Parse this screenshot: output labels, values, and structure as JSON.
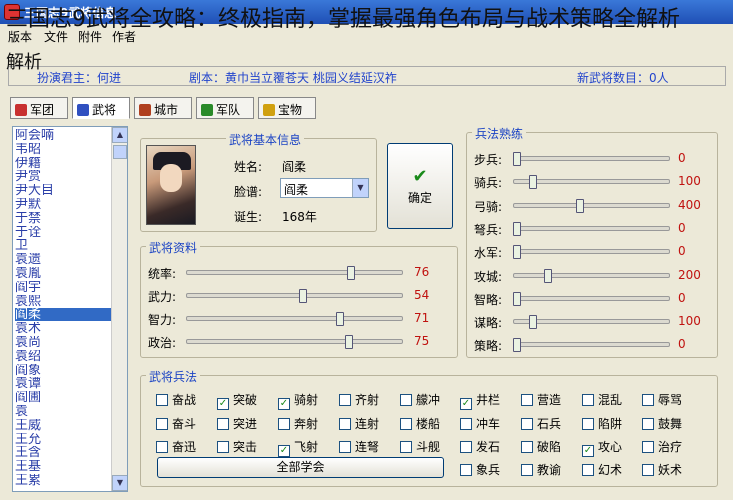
{
  "window": {
    "title": "三国志9武将信息"
  },
  "overlay": {
    "heading": "三国志9武将全攻略：终极指南，掌握最强角色布局与战术策略全解析",
    "tip": "解析"
  },
  "menu": [
    "版本",
    "文件",
    "附件",
    "作者"
  ],
  "infobar": {
    "ruler_label": "扮演君主：何进",
    "scenario_label": "剧本：黄巾当立覆苍天 桃园义结延汉祚",
    "new_generals_label": "新武将数目：0人"
  },
  "tabs": [
    {
      "label": "军团",
      "icon": "flag-icon",
      "color": "#c83030"
    },
    {
      "label": "武将",
      "icon": "general-icon",
      "color": "#3050c0"
    },
    {
      "label": "城市",
      "icon": "city-icon",
      "color": "#b04020"
    },
    {
      "label": "军队",
      "icon": "army-icon",
      "color": "#2a8a2a"
    },
    {
      "label": "宝物",
      "icon": "treasure-icon",
      "color": "#d0a010"
    }
  ],
  "general_list": {
    "items": [
      "阿会喃",
      "韦昭",
      "伊籍",
      "尹赏",
      "尹大目",
      "尹默",
      "于禁",
      "于诠",
      "卫",
      "袁遗",
      "袁胤",
      "阎宇",
      "袁熙",
      "阎柔",
      "袁术",
      "袁尚",
      "袁绍",
      "阎象",
      "袁谭",
      "阎圃",
      "袁",
      "王威",
      "王允",
      "王含",
      "王基",
      "王累"
    ],
    "selected": "阎柔"
  },
  "basic_info": {
    "title": "武将基本信息",
    "name_label": "姓名:",
    "name_value": "阎柔",
    "face_label": "脸谱:",
    "face_value": "阎柔",
    "birth_label": "诞生:",
    "birth_value": "168年"
  },
  "ok_button": {
    "label": "确定"
  },
  "stats": {
    "title": "武将资料",
    "items": [
      {
        "label": "统率:",
        "value": 76,
        "pct": 0.76
      },
      {
        "label": "武力:",
        "value": 54,
        "pct": 0.54
      },
      {
        "label": "智力:",
        "value": 71,
        "pct": 0.71
      },
      {
        "label": "政治:",
        "value": 75,
        "pct": 0.75
      }
    ]
  },
  "troops": {
    "title": "兵法熟练",
    "items": [
      {
        "label": "步兵:",
        "value": 0,
        "pct": 0.0
      },
      {
        "label": "骑兵:",
        "value": 100,
        "pct": 0.1
      },
      {
        "label": "弓骑:",
        "value": 400,
        "pct": 0.4
      },
      {
        "label": "弩兵:",
        "value": 0,
        "pct": 0.0
      },
      {
        "label": "水军:",
        "value": 0,
        "pct": 0.0
      },
      {
        "label": "攻城:",
        "value": 200,
        "pct": 0.2
      },
      {
        "label": "智略:",
        "value": 0,
        "pct": 0.0
      },
      {
        "label": "谋略:",
        "value": 100,
        "pct": 0.1
      },
      {
        "label": "策略:",
        "value": 0,
        "pct": 0.0
      }
    ]
  },
  "skills": {
    "title": "武将兵法",
    "rows": [
      [
        {
          "label": "奋战",
          "checked": false
        },
        {
          "label": "突破",
          "checked": true
        },
        {
          "label": "骑射",
          "checked": true
        },
        {
          "label": "齐射",
          "checked": false
        },
        {
          "label": "艨冲",
          "checked": false
        },
        {
          "label": "井栏",
          "checked": true
        },
        {
          "label": "营造",
          "checked": false
        },
        {
          "label": "混乱",
          "checked": false
        },
        {
          "label": "辱骂",
          "checked": false
        }
      ],
      [
        {
          "label": "奋斗",
          "checked": false
        },
        {
          "label": "突进",
          "checked": false
        },
        {
          "label": "奔射",
          "checked": false
        },
        {
          "label": "连射",
          "checked": false
        },
        {
          "label": "楼船",
          "checked": false
        },
        {
          "label": "冲车",
          "checked": false
        },
        {
          "label": "石兵",
          "checked": false
        },
        {
          "label": "陷阱",
          "checked": false
        },
        {
          "label": "鼓舞",
          "checked": false
        }
      ],
      [
        {
          "label": "奋迅",
          "checked": false
        },
        {
          "label": "突击",
          "checked": false
        },
        {
          "label": "飞射",
          "checked": true
        },
        {
          "label": "连弩",
          "checked": false
        },
        {
          "label": "斗舰",
          "checked": false
        },
        {
          "label": "发石",
          "checked": false
        },
        {
          "label": "破陷",
          "checked": false
        },
        {
          "label": "攻心",
          "checked": true
        },
        {
          "label": "治疗",
          "checked": false
        }
      ],
      [
        {
          "label": "象兵",
          "checked": false
        },
        {
          "label": "教谕",
          "checked": false
        },
        {
          "label": "幻术",
          "checked": false
        },
        {
          "label": "妖术",
          "checked": false
        }
      ]
    ],
    "learn_all_label": "全部学会"
  }
}
